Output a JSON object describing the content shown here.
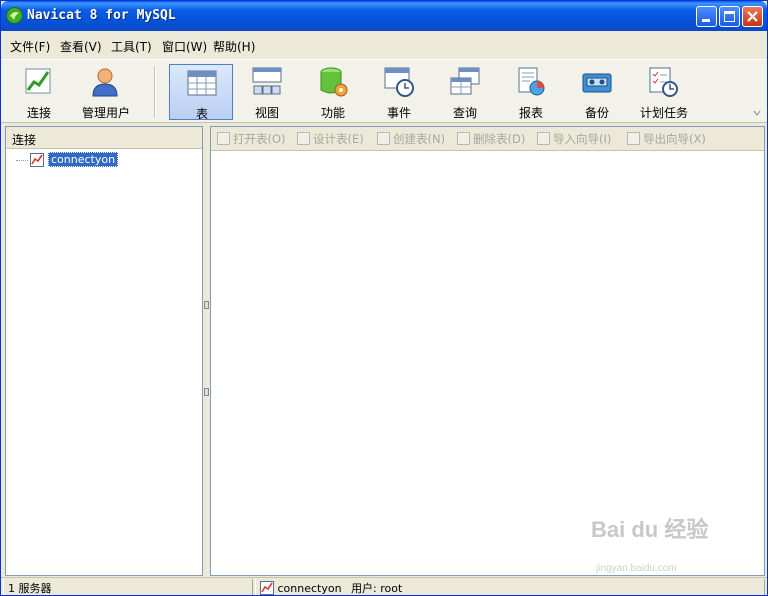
{
  "window": {
    "title": "Navicat 8 for MySQL"
  },
  "menu": [
    "文件(F)",
    "查看(V)",
    "工具(T)",
    "窗口(W)",
    "帮助(H)"
  ],
  "toolbar": {
    "connect": "连接",
    "manage_users": "管理用户",
    "table": "表",
    "view": "视图",
    "function": "功能",
    "event": "事件",
    "query": "查询",
    "report": "报表",
    "backup": "备份",
    "schedule": "计划任务"
  },
  "left_panel": {
    "header": "连接",
    "tree": [
      {
        "label": "connectyon"
      }
    ]
  },
  "object_toolbar": {
    "open_table": "打开表(O)",
    "design_table": "设计表(E)",
    "create_table": "创建表(N)",
    "delete_table": "删除表(D)",
    "import_wizard": "导入向导(I)",
    "export_wizard": "导出向导(X)"
  },
  "status": {
    "servers": "1 服务器",
    "connection": "connectyon",
    "user": "用户: root"
  },
  "watermark": {
    "text": "Bai du 经验",
    "sub": "jingyan.baidu.com"
  }
}
